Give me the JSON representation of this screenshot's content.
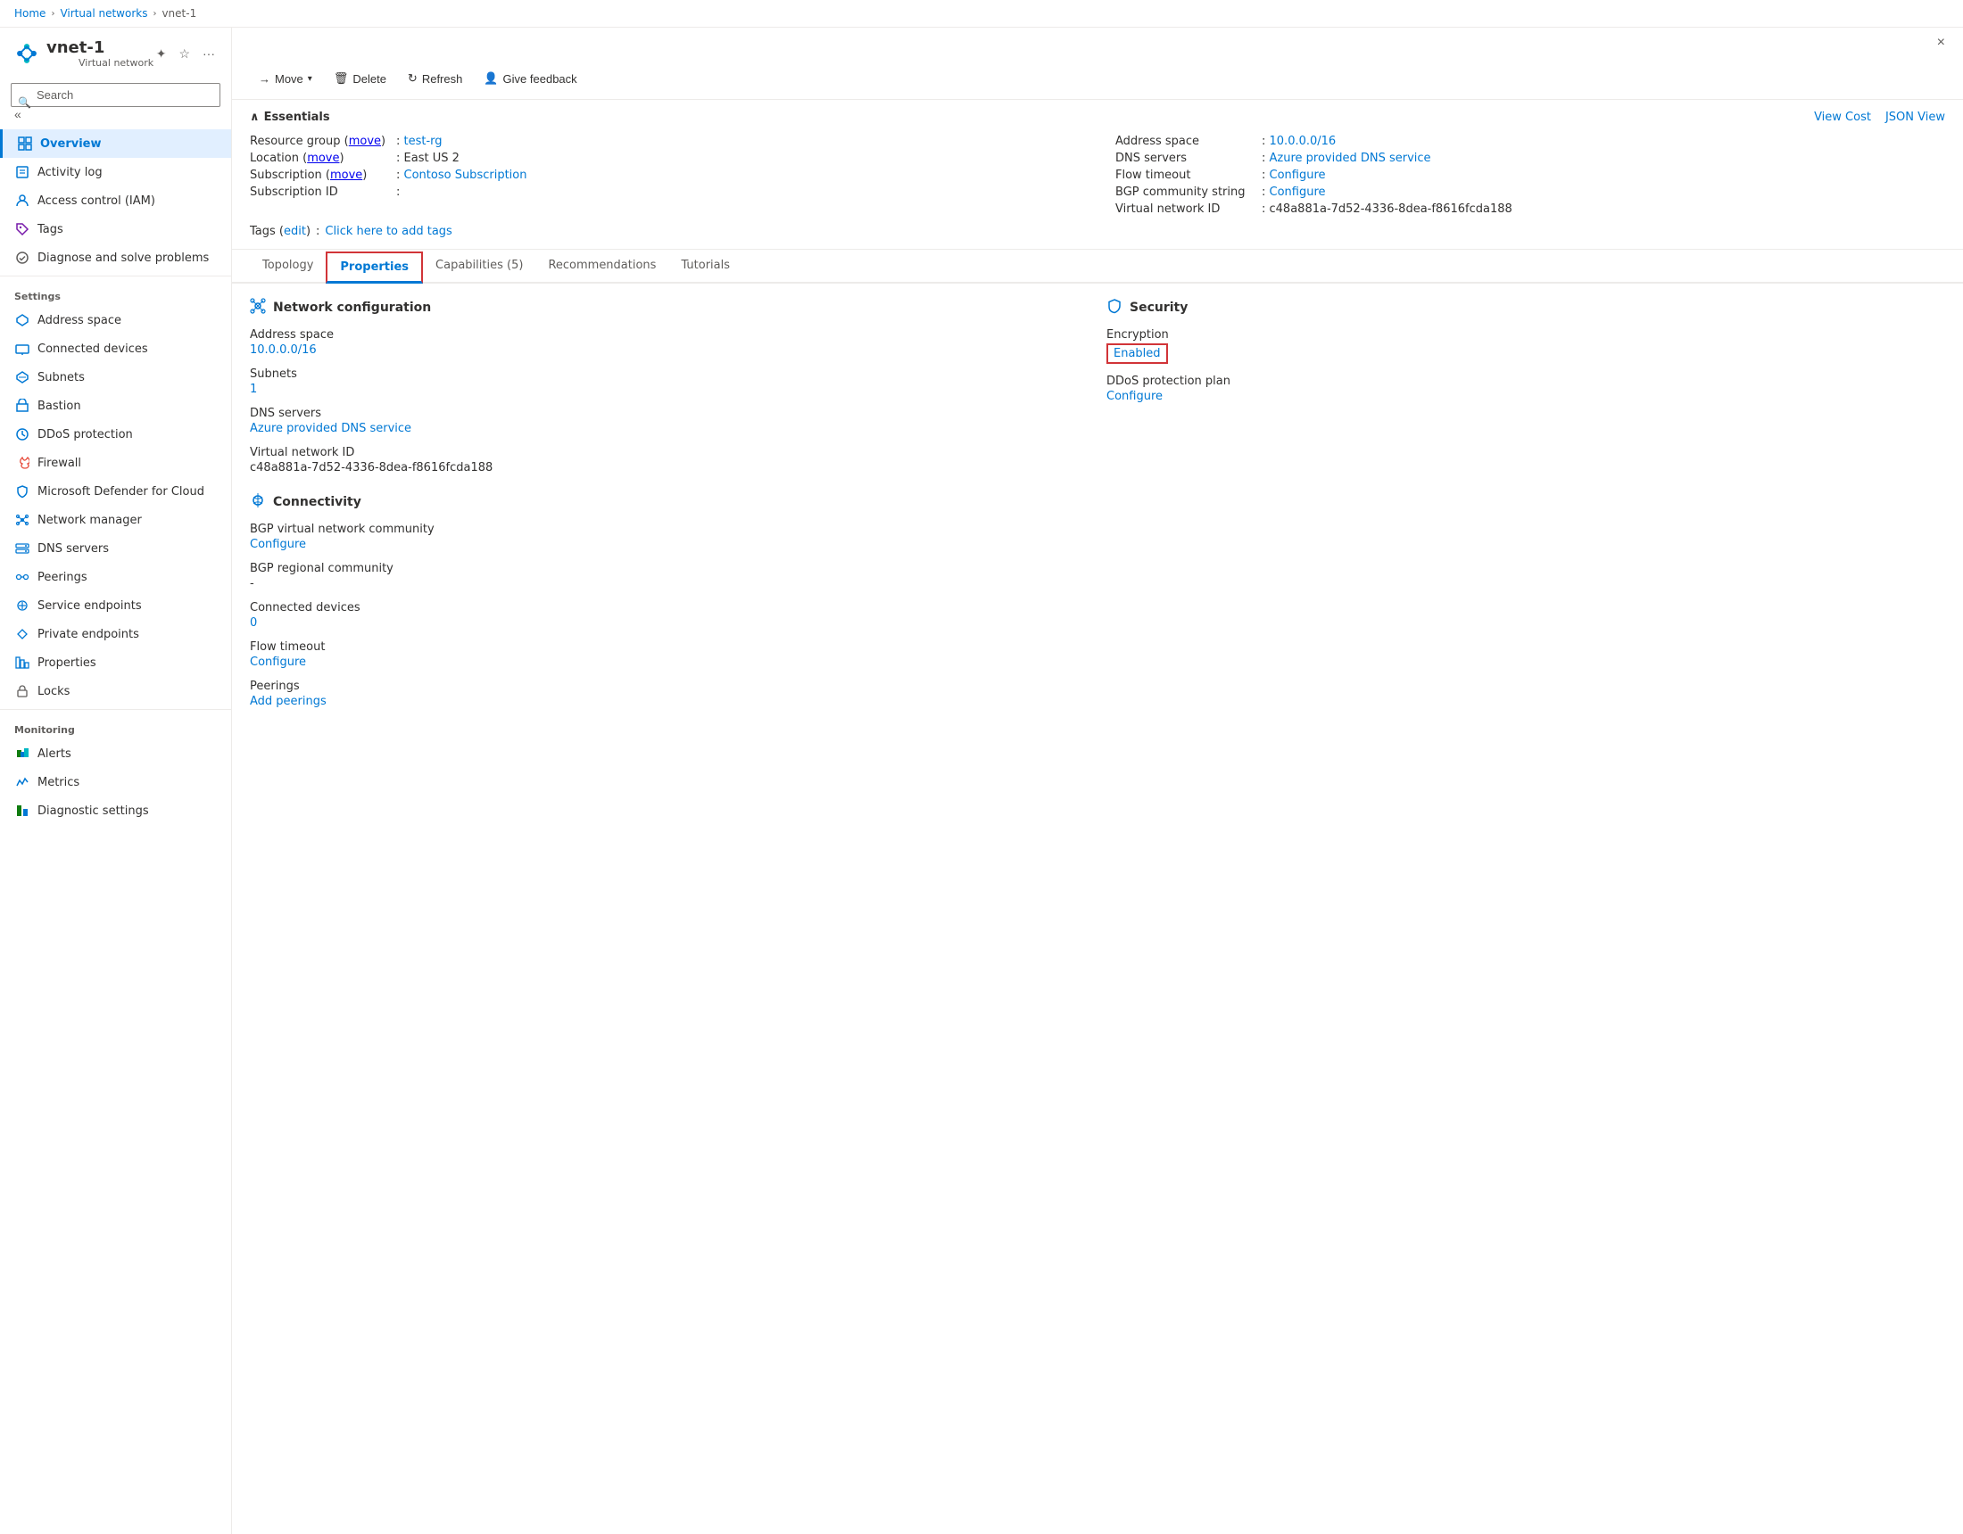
{
  "breadcrumb": {
    "home": "Home",
    "parent": "Virtual networks",
    "current": "vnet-1"
  },
  "header": {
    "title": "vnet-1",
    "subtitle": "Virtual network",
    "close_label": "×"
  },
  "toolbar": {
    "move_label": "Move",
    "delete_label": "Delete",
    "refresh_label": "Refresh",
    "feedback_label": "Give feedback"
  },
  "search": {
    "placeholder": "Search"
  },
  "sidebar": {
    "nav_items": [
      {
        "id": "overview",
        "label": "Overview",
        "active": true
      },
      {
        "id": "activity-log",
        "label": "Activity log"
      },
      {
        "id": "access-control",
        "label": "Access control (IAM)"
      },
      {
        "id": "tags",
        "label": "Tags"
      },
      {
        "id": "diagnose",
        "label": "Diagnose and solve problems"
      }
    ],
    "settings_label": "Settings",
    "settings_items": [
      {
        "id": "address-space",
        "label": "Address space"
      },
      {
        "id": "connected-devices",
        "label": "Connected devices"
      },
      {
        "id": "subnets",
        "label": "Subnets"
      },
      {
        "id": "bastion",
        "label": "Bastion"
      },
      {
        "id": "ddos-protection",
        "label": "DDoS protection"
      },
      {
        "id": "firewall",
        "label": "Firewall"
      },
      {
        "id": "microsoft-defender",
        "label": "Microsoft Defender for Cloud"
      },
      {
        "id": "network-manager",
        "label": "Network manager"
      },
      {
        "id": "dns-servers",
        "label": "DNS servers"
      },
      {
        "id": "peerings",
        "label": "Peerings"
      },
      {
        "id": "service-endpoints",
        "label": "Service endpoints"
      },
      {
        "id": "private-endpoints",
        "label": "Private endpoints"
      },
      {
        "id": "properties",
        "label": "Properties"
      },
      {
        "id": "locks",
        "label": "Locks"
      }
    ],
    "monitoring_label": "Monitoring",
    "monitoring_items": [
      {
        "id": "alerts",
        "label": "Alerts"
      },
      {
        "id": "metrics",
        "label": "Metrics"
      },
      {
        "id": "diagnostic-settings",
        "label": "Diagnostic settings"
      }
    ]
  },
  "essentials": {
    "collapse_label": "Essentials",
    "view_cost_label": "View Cost",
    "json_view_label": "JSON View",
    "fields_left": [
      {
        "label": "Resource group (move)",
        "value": "test-rg",
        "is_link": true
      },
      {
        "label": "Location (move)",
        "value": "East US 2",
        "is_link": false
      },
      {
        "label": "Subscription (move)",
        "value": "Contoso Subscription",
        "is_link": true
      },
      {
        "label": "Subscription ID",
        "value": "",
        "is_link": false
      }
    ],
    "fields_right": [
      {
        "label": "Address space",
        "value": "10.0.0.0/16",
        "is_link": true
      },
      {
        "label": "DNS servers",
        "value": "Azure provided DNS service",
        "is_link": true
      },
      {
        "label": "Flow timeout",
        "value": "Configure",
        "is_link": true
      },
      {
        "label": "BGP community string",
        "value": "Configure",
        "is_link": true
      },
      {
        "label": "Virtual network ID",
        "value": "c48a881a-7d52-4336-8dea-f8616fcda188",
        "is_link": false
      }
    ],
    "tags_label": "Tags (edit)",
    "tags_value": "Click here to add tags"
  },
  "tabs": [
    {
      "id": "topology",
      "label": "Topology"
    },
    {
      "id": "properties",
      "label": "Properties",
      "active": true,
      "highlighted": true
    },
    {
      "id": "capabilities",
      "label": "Capabilities (5)"
    },
    {
      "id": "recommendations",
      "label": "Recommendations"
    },
    {
      "id": "tutorials",
      "label": "Tutorials"
    }
  ],
  "properties_page": {
    "network_config": {
      "section_title": "Network configuration",
      "fields": [
        {
          "label": "Address space",
          "value": "10.0.0.0/16",
          "is_link": true
        },
        {
          "label": "Subnets",
          "value": "1",
          "is_link": true
        },
        {
          "label": "DNS servers",
          "value": "Azure provided DNS service",
          "is_link": true
        },
        {
          "label": "Virtual network ID",
          "value": "c48a881a-7d52-4336-8dea-f8616fcda188",
          "is_link": false
        }
      ]
    },
    "connectivity": {
      "section_title": "Connectivity",
      "fields": [
        {
          "label": "BGP virtual network community",
          "value": "Configure",
          "is_link": true
        },
        {
          "label": "BGP regional community",
          "value": "-",
          "is_link": false
        },
        {
          "label": "Connected devices",
          "value": "0",
          "is_link": true
        },
        {
          "label": "Flow timeout",
          "value": "Configure",
          "is_link": true
        },
        {
          "label": "Peerings",
          "value": "Add peerings",
          "is_link": true
        }
      ]
    },
    "security": {
      "section_title": "Security",
      "fields": [
        {
          "label": "Encryption",
          "value": "Enabled",
          "is_link": true,
          "highlighted": true
        },
        {
          "label": "DDoS protection plan",
          "value": "Configure",
          "is_link": true
        }
      ]
    }
  }
}
